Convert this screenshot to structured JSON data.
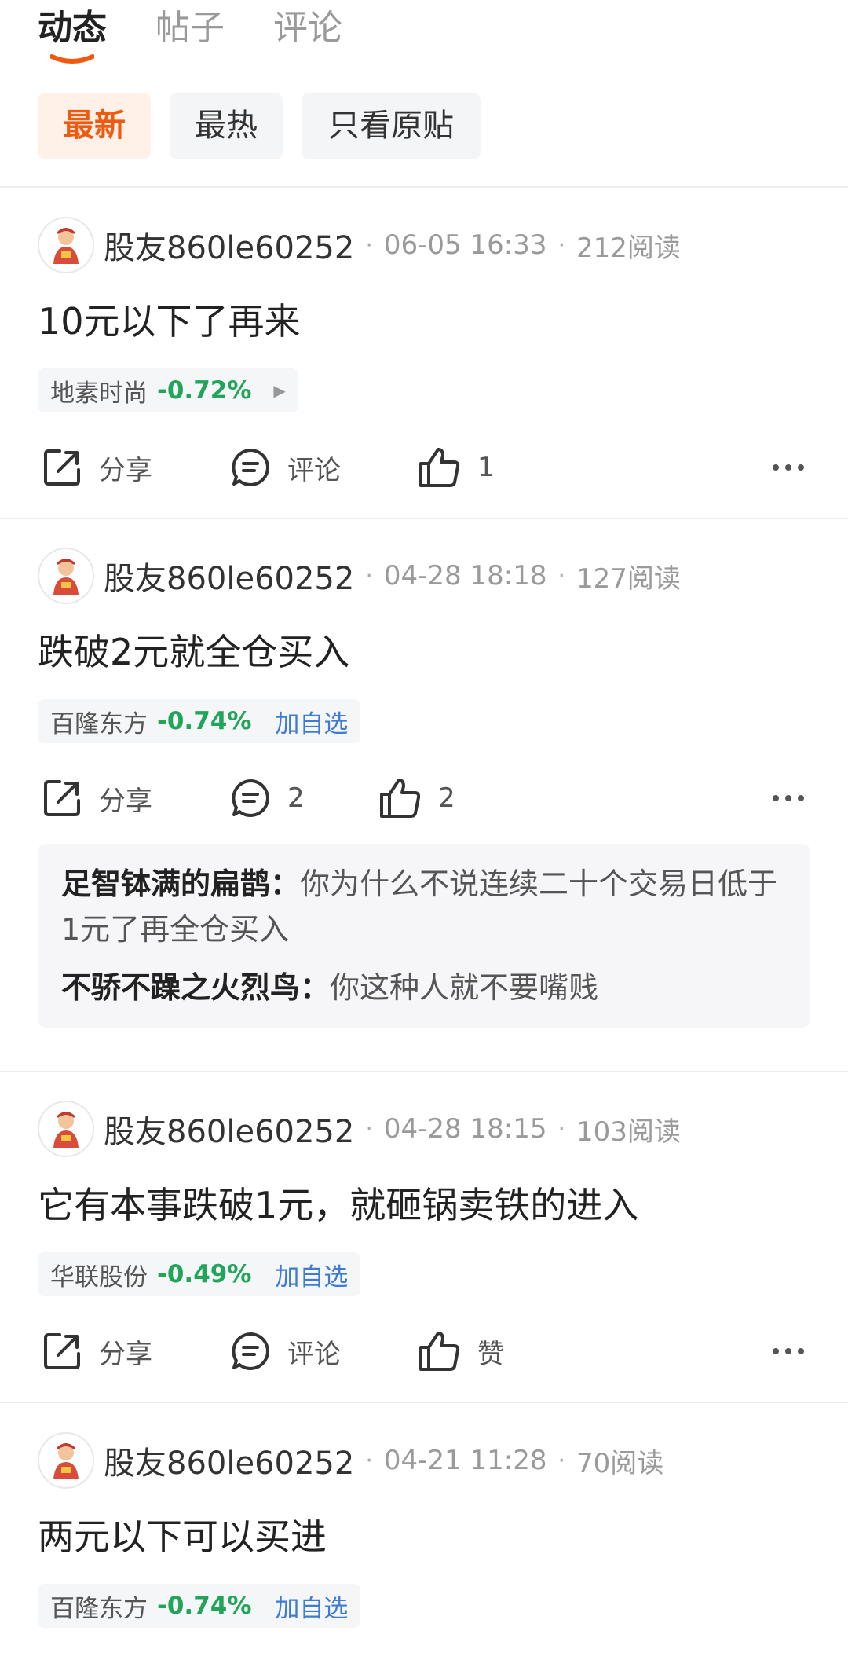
{
  "tabs": [
    "动态",
    "帖子",
    "评论"
  ],
  "filters": [
    "最新",
    "最热",
    "只看原贴"
  ],
  "accent_color": "#f05a10",
  "down_color": "#22a55b",
  "link_color": "#3e7bd4",
  "posts": [
    {
      "user": "股友860le60252",
      "time": "06-05 16:33",
      "reads": "212阅读",
      "content": "10元以下了再来",
      "stock": {
        "name": "地素时尚",
        "change": "-0.72%",
        "action": ""
      },
      "share": "分享",
      "comment": "评论",
      "like": "1"
    },
    {
      "user": "股友860le60252",
      "time": "04-28 18:18",
      "reads": "127阅读",
      "content": "跌破2元就全仓买入",
      "stock": {
        "name": "百隆东方",
        "change": "-0.74%",
        "action": "加自选"
      },
      "share": "分享",
      "comment": "2",
      "like": "2",
      "replies": [
        {
          "author": "足智钵满的扁鹊：",
          "text": "你为什么不说连续二十个交易日低于1元了再全仓买入"
        },
        {
          "author": "不骄不躁之火烈鸟：",
          "text": "你这种人就不要嘴贱"
        }
      ]
    },
    {
      "user": "股友860le60252",
      "time": "04-28 18:15",
      "reads": "103阅读",
      "content": "它有本事跌破1元，就砸锅卖铁的进入",
      "stock": {
        "name": "华联股份",
        "change": "-0.49%",
        "action": "加自选"
      },
      "share": "分享",
      "comment": "评论",
      "like": "赞"
    },
    {
      "user": "股友860le60252",
      "time": "04-21 11:28",
      "reads": "70阅读",
      "content": "两元以下可以买进",
      "stock": {
        "name": "百隆东方",
        "change": "-0.74%",
        "action": "加自选"
      }
    }
  ]
}
